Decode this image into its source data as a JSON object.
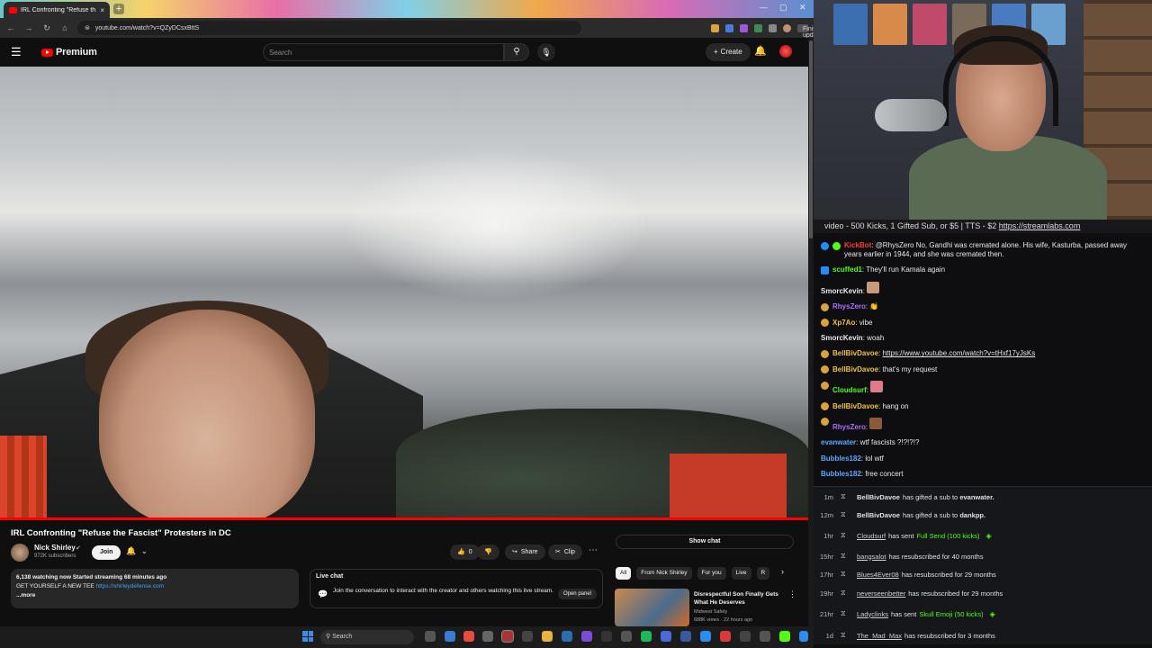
{
  "browser": {
    "tab_title": "IRL Confronting \"Refuse th...",
    "new_tab": "+",
    "tab_close": "×",
    "url": "youtube.com/watch?v=QZyDCsxBttS",
    "finish_update": "Finish update",
    "win_min": "—",
    "win_max": "▢",
    "win_close": "✕"
  },
  "yt": {
    "brand": "Premium",
    "search_placeholder": "Search",
    "create": "Create",
    "video_title": "IRL Confronting \"Refuse the Fascist\" Protesters in DC",
    "channel_name": "Nick Shirley",
    "subscribers": "972K subscribers",
    "join": "Join",
    "like_count": "0",
    "share": "Share",
    "clip": "Clip",
    "desc_line1": "6,138 watching now  Started streaming 68 minutes ago",
    "desc_line2": "GET YOURSELF A NEW TEE",
    "desc_link": "https://shirleydefense.com",
    "desc_more": "...more",
    "live_chat_title": "Live chat",
    "live_chat_text": "Join the conversation to interact with the creator and others watching this live stream.",
    "open_panel": "Open panel",
    "show_chat": "Show chat",
    "chips": [
      "All",
      "From Nick Shirley",
      "For you",
      "Live",
      "R"
    ],
    "rec_title": "Disrespectful Son Finally Gets What He Deserves",
    "rec_channel": "Midwest Safety",
    "rec_meta": "688K views · 22 hours ago"
  },
  "stream": {
    "ticker_text": "video - 500 Kicks, 1 Gifted Sub, or $5 | TTS - $2",
    "ticker_link": "https://streamlabs.com",
    "chat": [
      {
        "user": "KickBot",
        "color": "#ff3b3b",
        "text": "@RhysZero No, Gandhi was cremated alone. His wife, Kasturba, passed away years earlier in 1944, and she was cremated then."
      },
      {
        "user": "scuffed1",
        "color": "#53fc18",
        "text": "They'll run Kamala again"
      },
      {
        "user": "SmorcKevin",
        "color": "#e8e8e8",
        "text": ""
      },
      {
        "user": "RhysZero",
        "color": "#b26bff",
        "text": ""
      },
      {
        "user": "Xp7Ao",
        "color": "#f0c040",
        "text": "vibe"
      },
      {
        "user": "SmorcKevin",
        "color": "#e8e8e8",
        "text": "woah"
      },
      {
        "user": "BellBivDavoe",
        "color": "#f0c040",
        "text": "https://www.youtube.com/watch?v=tHxf17yJsKs"
      },
      {
        "user": "BellBivDavoe",
        "color": "#f0c040",
        "text": "that's my request"
      },
      {
        "user": "Cloudsurf",
        "color": "#53fc18",
        "text": ""
      },
      {
        "user": "BellBivDavoe",
        "color": "#f0c040",
        "text": "hang on"
      },
      {
        "user": "RhysZero",
        "color": "#b26bff",
        "text": ""
      },
      {
        "user": "evanwater",
        "color": "#5aa9ff",
        "text": "wtf fascists ?!?!?!?"
      },
      {
        "user": "Bubbles182",
        "color": "#5aa9ff",
        "text": "lol wtf"
      },
      {
        "user": "Bubbles182",
        "color": "#5aa9ff",
        "text": "free concert"
      }
    ],
    "events": [
      {
        "time": "1m",
        "user": "BellBivDavoe",
        "action": "has gifted a sub to",
        "target": "evanwater."
      },
      {
        "time": "12m",
        "user": "BellBivDavoe",
        "action": "has gifted a sub to",
        "target": "dankpp."
      },
      {
        "time": "1hr",
        "user": "Cloudsurf",
        "action": "has sent",
        "gift": "Full Send (100 kicks)"
      },
      {
        "time": "15hr",
        "user": "bangsalot",
        "action": "has resubscribed for 40 months"
      },
      {
        "time": "17hr",
        "user": "Blues4Ever08",
        "action": "has resubscribed for 29 months"
      },
      {
        "time": "19hr",
        "user": "neverseenbetter",
        "action": "has resubscribed for 29 months"
      },
      {
        "time": "21hr",
        "user": "Ladyclinks",
        "action": "has sent",
        "gift": "Skull Emoji (50 kicks)"
      },
      {
        "time": "1d",
        "user": "The_Mad_Max",
        "action": "has resubscribed for 3 months"
      }
    ]
  },
  "taskbar": {
    "search": "Search"
  }
}
